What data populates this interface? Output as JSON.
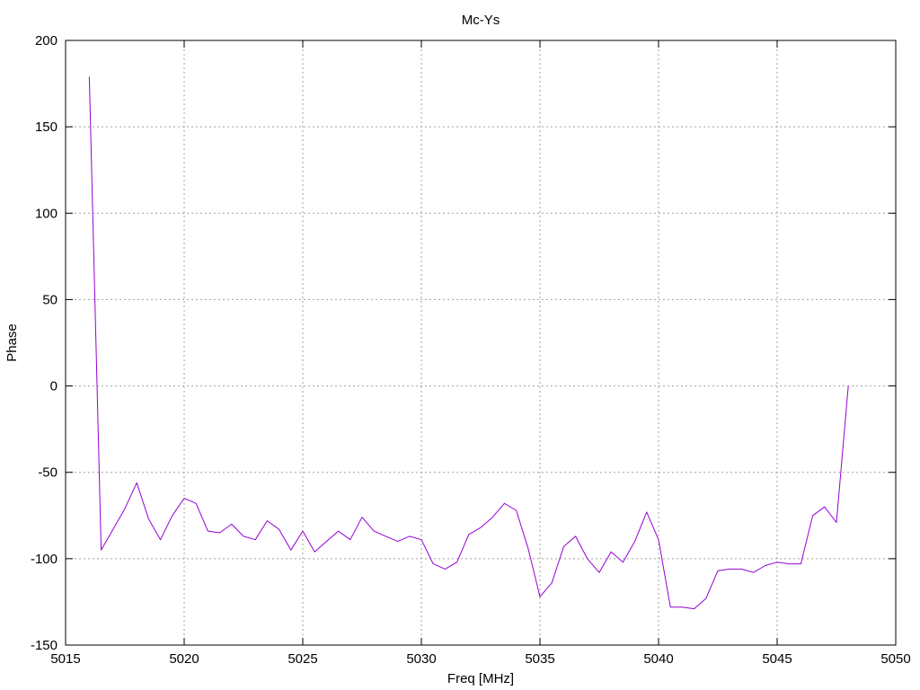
{
  "chart_data": {
    "type": "line",
    "title": "Mc-Ys",
    "xlabel": "Freq [MHz]",
    "ylabel": "Phase",
    "xlim": [
      5015,
      5050
    ],
    "ylim": [
      -150,
      200
    ],
    "xticks": [
      5015,
      5020,
      5025,
      5030,
      5035,
      5040,
      5045,
      5050
    ],
    "yticks": [
      -150,
      -100,
      -50,
      0,
      50,
      100,
      150,
      200
    ],
    "grid": true,
    "series_color": "#9400d3",
    "x": [
      5016.0,
      5016.5,
      5017.0,
      5017.5,
      5018.0,
      5018.5,
      5019.0,
      5019.5,
      5020.0,
      5020.5,
      5021.0,
      5021.5,
      5022.0,
      5022.5,
      5023.0,
      5023.5,
      5024.0,
      5024.5,
      5025.0,
      5025.5,
      5026.0,
      5026.5,
      5027.0,
      5027.5,
      5028.0,
      5028.5,
      5029.0,
      5029.5,
      5030.0,
      5030.5,
      5031.0,
      5031.5,
      5032.0,
      5032.5,
      5033.0,
      5033.5,
      5034.0,
      5034.5,
      5035.0,
      5035.5,
      5036.0,
      5036.5,
      5037.0,
      5037.5,
      5038.0,
      5038.5,
      5039.0,
      5039.5,
      5040.0,
      5040.5,
      5041.0,
      5041.5,
      5042.0,
      5042.5,
      5043.0,
      5043.5,
      5044.0,
      5044.5,
      5045.0,
      5045.5,
      5046.0,
      5046.5,
      5047.0,
      5047.5,
      5048.0
    ],
    "y": [
      179,
      -95,
      -83,
      -71,
      -56,
      -77,
      -89,
      -75,
      -65,
      -68,
      -84,
      -85,
      -80,
      -87,
      -89,
      -78,
      -83,
      -95,
      -84,
      -96,
      -90,
      -84,
      -89,
      -76,
      -84,
      -87,
      -90,
      -87,
      -89,
      -103,
      -106,
      -102,
      -86,
      -82,
      -76,
      -68,
      -72,
      -94,
      -122,
      -114,
      -93,
      -87,
      -100,
      -108,
      -96,
      -102,
      -90,
      -73,
      -89,
      -128,
      -128,
      -129,
      -123,
      -107,
      -106,
      -106,
      -108,
      -104,
      -102,
      -103,
      -103,
      -75,
      -70,
      -79,
      0
    ]
  }
}
